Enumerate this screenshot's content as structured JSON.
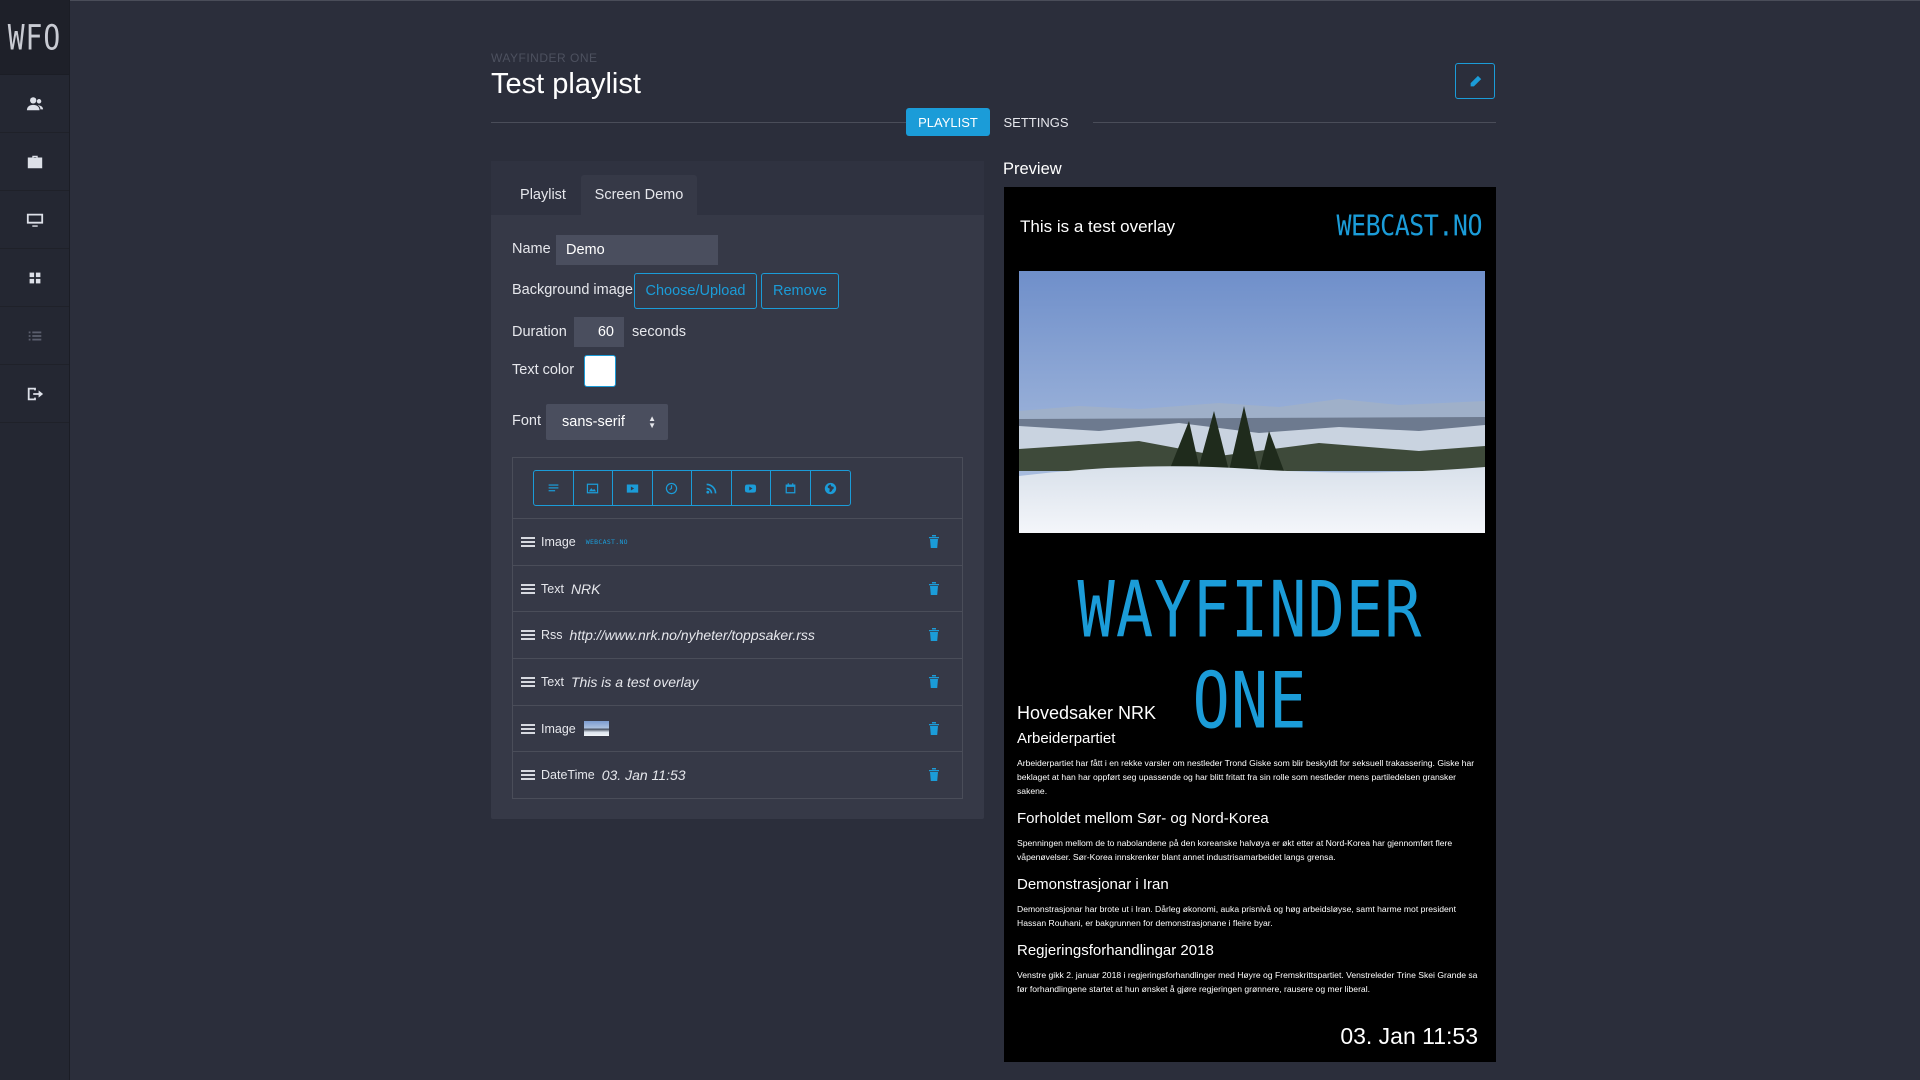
{
  "app": {
    "logo": "WFO",
    "subtitle": "WAYFINDER ONE",
    "title": "Test playlist"
  },
  "sidebar": {
    "items": [
      {
        "icon": "users-icon"
      },
      {
        "icon": "briefcase-icon"
      },
      {
        "icon": "monitor-icon"
      },
      {
        "icon": "grid-icon"
      },
      {
        "icon": "list-icon"
      },
      {
        "icon": "sign-out-icon"
      }
    ]
  },
  "main_tabs": {
    "playlist": "PLAYLIST",
    "settings": "SETTINGS",
    "active": "PLAYLIST"
  },
  "panel": {
    "tabs": [
      "Playlist",
      "Screen Demo"
    ],
    "active_tab": "Screen Demo",
    "name_label": "Name",
    "name_value": "Demo",
    "bg_label": "Background image",
    "choose_label": "Choose/Upload",
    "remove_label": "Remove",
    "duration_label": "Duration",
    "duration_value": "60",
    "duration_unit": "seconds",
    "text_color_label": "Text color",
    "text_color": "#ffffff",
    "font_label": "Font",
    "font_value": "sans-serif"
  },
  "toolbar": [
    "text-icon",
    "image-icon",
    "video-icon",
    "clock-icon",
    "rss-icon",
    "youtube-icon",
    "calendar-icon",
    "globe-icon"
  ],
  "elements": [
    {
      "type": "Image",
      "value": "WEBCAST.NO",
      "kind": "logo-thumb"
    },
    {
      "type": "Text",
      "value": "NRK"
    },
    {
      "type": "Rss",
      "value": "http://www.nrk.no/nyheter/toppsaker.rss"
    },
    {
      "type": "Text",
      "value": "This is a test overlay"
    },
    {
      "type": "Image",
      "value": "",
      "kind": "photo-thumb"
    },
    {
      "type": "DateTime",
      "value": "03. Jan 11:53"
    }
  ],
  "preview": {
    "label": "Preview",
    "overlay_text": "This is a test overlay",
    "logo_text": "WEBCAST.NO",
    "big_title": "WAYFINDER ONE",
    "rss_heading": "Hovedsaker NRK",
    "rss_items": [
      {
        "title": "Arbeiderpartiet",
        "body": "Arbeiderpartiet har fått i en rekke varsler om nestleder Trond Giske som blir beskyldt for seksuell trakassering. Giske har beklaget at han har oppført seg upassende og har blitt fritatt fra sin rolle som nestleder mens partiledelsen gransker sakene."
      },
      {
        "title": "Forholdet mellom Sør- og Nord-Korea",
        "body": "Spenningen mellom de to nabolandene på den koreanske halvøya er økt etter at Nord-Korea har gjennomført flere våpenøvelser. Sør-Korea innskrenker blant annet industrisamarbeidet langs grensa."
      },
      {
        "title": "Demonstrasjonar i Iran",
        "body": "Demonstrasjonar har brote ut i Iran. Dårleg økonomi, auka prisnivå og høg arbeidsløyse, samt harme mot president Hassan Rouhani, er bakgrunnen for demonstrasjonane i fleire byar."
      },
      {
        "title": "Regjeringsforhandlingar 2018",
        "body": "Venstre gikk 2. januar 2018 i regjeringsforhandlinger med Høyre og Fremskrittspartiet. Venstreleder Trine Skei Grande sa før forhandlingene startet at hun ønsket å gjøre regjeringen grønnere, rausere og mer liberal."
      }
    ],
    "datetime": "03. Jan 11:53"
  },
  "colors": {
    "accent": "#1b9cd8",
    "background": "#2b2e3b",
    "sidebar": "#242732",
    "panel": "#363947"
  }
}
